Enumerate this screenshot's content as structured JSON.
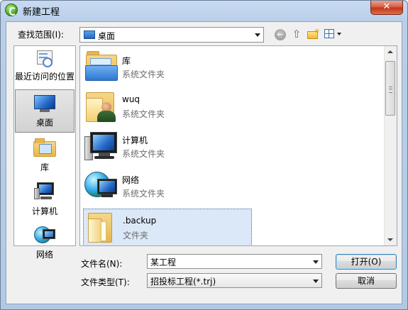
{
  "window": {
    "title": "新建工程",
    "close_glyph": "✕"
  },
  "toolbar": {
    "look_in_label": "查找范围(I):",
    "look_in_value": "桌面",
    "back_glyph": "←",
    "up_glyph": "⇧",
    "newfolder_glyph": "✳"
  },
  "places": [
    {
      "label": "最近访问的位置",
      "icon": "recent-places-icon"
    },
    {
      "label": "桌面",
      "icon": "desktop-icon",
      "selected": true
    },
    {
      "label": "库",
      "icon": "libraries-icon"
    },
    {
      "label": "计算机",
      "icon": "computer-icon"
    },
    {
      "label": "网络",
      "icon": "network-icon"
    }
  ],
  "files": [
    {
      "name": "库",
      "type": "系统文件夹",
      "icon": "libraries-folder-icon"
    },
    {
      "name": "wuq",
      "type": "系统文件夹",
      "icon": "user-folder-icon"
    },
    {
      "name": "计算机",
      "type": "系统文件夹",
      "icon": "computer-icon"
    },
    {
      "name": "网络",
      "type": "系统文件夹",
      "icon": "network-icon"
    },
    {
      "name": ".backup",
      "type": "文件夹",
      "icon": "folder-icon",
      "selected": true
    }
  ],
  "footer": {
    "filename_label": "文件名(N):",
    "filename_value": "某工程",
    "filetype_label": "文件类型(T):",
    "filetype_value": "招投标工程(*.trj)",
    "open_label": "打开(O)",
    "cancel_label": "取消"
  }
}
